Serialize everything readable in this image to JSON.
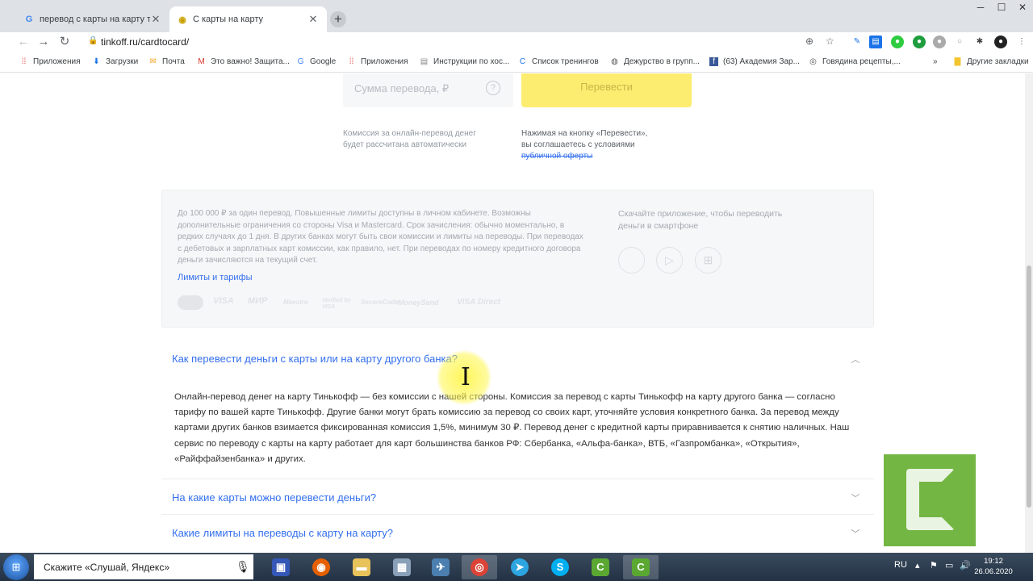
{
  "tabs": [
    {
      "title": "перевод с карты на карту тинькофф",
      "favicon": "G",
      "active": false
    },
    {
      "title": "С карты на карту",
      "favicon": "◉",
      "active": true
    }
  ],
  "toolbar": {
    "url": "tinkoff.ru/cardtocard/",
    "back": "←",
    "forward": "→",
    "reload": "↻"
  },
  "bookmarks": [
    {
      "label": "Приложения",
      "icon": "apps-grid-icon",
      "color": "#e8453c"
    },
    {
      "label": "Загрузки",
      "icon": "download-icon",
      "color": "#1a73e8"
    },
    {
      "label": "Почта",
      "icon": "mail-icon",
      "color": "#f4a320"
    },
    {
      "label": "Это важно! Защита...",
      "icon": "gmail-icon",
      "color": "#d93025"
    },
    {
      "label": "Google",
      "icon": "google-icon",
      "color": "#4285f4"
    },
    {
      "label": "Приложения",
      "icon": "apps-grid-icon",
      "color": "#e8453c"
    },
    {
      "label": "Инструкции по хос...",
      "icon": "doc-icon",
      "color": "#888888"
    },
    {
      "label": "Список тренингов",
      "icon": "c-icon",
      "color": "#1a73e8"
    },
    {
      "label": "Дежурство в групп...",
      "icon": "globe-icon",
      "color": "#555555"
    },
    {
      "label": "(63) Академия Зар...",
      "icon": "facebook-icon",
      "color": "#3b5998"
    },
    {
      "label": "Говядина рецепты,...",
      "icon": "chrome-icon",
      "color": "#555555"
    }
  ],
  "bookmarks_more": "»",
  "other_bookmarks": "Другие закладки",
  "transfer": {
    "amount_placeholder": "Сумма перевода, ₽",
    "help": "?",
    "submit_label": "Перевести",
    "fee_note": [
      "Комиссия за онлайн-перевод денег",
      "будет рассчитана автоматически"
    ],
    "consent_note": [
      "Нажимая на кнопку «Перевести»,",
      "вы соглашаетесь с условиями"
    ],
    "offer_link": "публичной оферты"
  },
  "info": {
    "text": "До 100 000 ₽ за один перевод. Повышенные лимиты доступны в личном кабинете. Возможны дополнительные ограничения со стороны Visa и Mastercard. Срок зачисления: обычно моментально, в редких случаях до 1 дня. В других банках могут быть свои комиссии и лимиты на переводы. При переводах с дебетовых и зарплатных карт комиссии, как правило, нет. При переводах по номеру кредитного договора деньги зачисляются на текущий счет.",
    "limits_link": "Лимиты и тарифы",
    "app_text": "Скачайте приложение, чтобы переводить деньги в смартфоне",
    "stores": [
      "apple-icon",
      "play-icon",
      "windows-icon"
    ],
    "payment_systems": [
      "VISA",
      "МИР",
      "Maestro",
      "Verified by VISA",
      "SecureCode",
      "MoneySend",
      "VISA Direct"
    ]
  },
  "faq": [
    {
      "question": "Как перевести деньги с карты или на карту другого банка?",
      "expanded": true,
      "answer": "Онлайн-перевод денег на карту Тинькофф — без комиссии с нашей стороны. Комиссия за перевод с карты Тинькофф на карту другого банка — согласно тарифу по вашей карте Тинькофф. Другие банки могут брать комиссию за перевод со своих карт, уточняйте условия конкретного банка. За перевод между картами других банков взимается фиксированная комиссия 1,5%, минимум 30 ₽. Перевод денег с кредитной карты приравнивается к снятию наличных. Наш сервис по переводу с карты на карту работает для карт большинства банков РФ: Сбербанка, «Альфа-банка», ВТБ, «Газпромбанка», «Открытия», «Райффайзенбанка» и других."
    },
    {
      "question": "На какие карты можно перевести деньги?",
      "expanded": false
    },
    {
      "question": "Какие лимиты на переводы с карту на карту?",
      "expanded": false
    }
  ],
  "taskbar": {
    "search_text": "Скажите «Слушай, Яндекс»",
    "lang": "RU",
    "time": "19:12",
    "date": "26.06.2020"
  }
}
